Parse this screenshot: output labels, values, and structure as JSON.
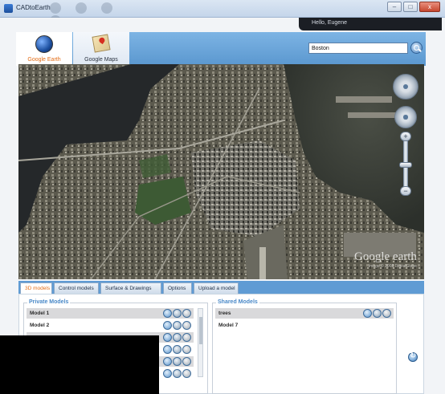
{
  "window": {
    "title": "CADtoEarth",
    "buttons": {
      "minimize": "–",
      "maximize": "□",
      "close": "x"
    }
  },
  "user": {
    "greeting": "Hello, Eugene"
  },
  "view_tabs": [
    {
      "label": "Google Earth",
      "icon": "earth-icon",
      "active": true
    },
    {
      "label": "Google Maps",
      "icon": "map-pin-icon",
      "active": false
    }
  ],
  "search": {
    "value": "Boston"
  },
  "map": {
    "watermark": "Google earth",
    "watermark_sub": "Image © 2008 DigitalGlobe",
    "zoom_plus": "+",
    "zoom_minus": "−"
  },
  "model_tabs": [
    {
      "label": "3D models",
      "active": true
    },
    {
      "label": "Control models",
      "active": false
    },
    {
      "label": "Surface & Drawings",
      "active": false
    },
    {
      "label": "Options",
      "active": false
    },
    {
      "label": "Upload a model",
      "active": false
    }
  ],
  "private_models": {
    "title": "Private Models",
    "rows": [
      {
        "name": "Model 1"
      },
      {
        "name": "Model 2"
      }
    ]
  },
  "shared_models": {
    "title": "Shared Models",
    "rows": [
      {
        "name": "trees"
      },
      {
        "name": "Model 7"
      }
    ]
  },
  "colors": {
    "accent": "#e36d16",
    "header_blue": "#5a97cf",
    "tab_strip": "#5f9bd4"
  }
}
